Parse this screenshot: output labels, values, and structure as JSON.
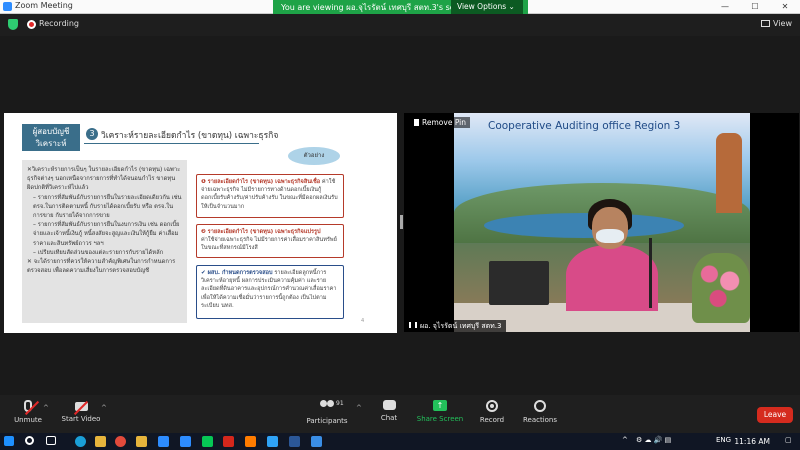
{
  "window": {
    "title": "Zoom Meeting",
    "minimize": "—",
    "maximize": "☐",
    "close": "✕"
  },
  "topbar": {
    "recording_label": "Recording",
    "view_label": "View"
  },
  "banner": {
    "text": "You are viewing ผอ.จุไรรัตน์ เทศบุรี สตท.3's screen",
    "options_label": "View Options ⌄"
  },
  "slide": {
    "section_box": "ผู้สอบบัญชี\nวิเคราะห์",
    "step_number": "3",
    "heading": "วิเคราะห์รายละเอียดกำไร (ขาดทุน) เฉพาะธุรกิจ",
    "example_label": "ตัวอย่าง",
    "left_items": [
      "✕วิเคราะห์รายการเป็นๆ ในรายละเอียดกำไร (ขาดทุน) เฉพาะธุรกิจต่างๆ นอกเหนือจากรายการที่ทำได้จนอนกำไร ขาดทุนผิดปกติที่วิเคราะห์ไปแล้ว",
      "– รายการที่สัมพันธ์กับรายการยืนในรายละเอียดเดียวกัน เช่น ตรจ.ในการติดตามหนี้ กับรายได้ดอกเบี้ยรับ หรือ ตรจ.ในการขาย กับรายได้จากการขาย",
      "– รายการที่สัมพันธ์กับรายการยืนในงบการเงิน เช่น ดอกเบี้ยจ่ายและเจ้าหนี้เงินกู้ หนี้สงสัยจะสูญและเงินให้กู้ยืม ค่าเสื่อมราคาและสินทรัพย์ถาวร ฯลฯ",
      "– เปรียบเทียบสัดส่วนของแต่ละรายการกับรายได้หลัก",
      "✕ จะได้รายการที่ควรให้ความสำคัญพิเศษในการกำหนดการตรวจสอบ เพื่อลดความเสี่ยงในการตรวจสอบบัญชี"
    ],
    "box1": {
      "label": "❶ รายละเอียดกำไร (ขาดทุน) เฉพาะธุรกิจสินเชื่อ",
      "text": "ค่าใช้จ่ายเฉพาะธุรกิจ ไม่มีรายการทางด้านดอกเบี้ยเงินกู้ดอกเบี้ยรับค้างรับ/ค่าปรับค้างรับ ในขณะที่มีดอกผลเงินรับให้เป็นจำนวนมาก"
    },
    "box2": {
      "label": "❷ รายละเอียดกำไร (ขาดทุน) เฉพาะธุรกิจแปรรูป",
      "text": "ค่าใช้จ่ายเฉพาะธุรกิจ ไม่มีรายการค่าเสื่อมราคาสินทรัพย์ ในขณะที่สหกรณ์มีโรงสี"
    },
    "box3": {
      "label": "✔ ผสบ. กำหนดการตรวจสอบ",
      "text": "รายละเอียดลูกหนี้การวิเคราะห์อายุหนี้ ผลการประเมินความคุ้มค่า และรายละเอียดที่ดินอาคารและอุปกรณ์การคำนวณค่าเสื่อมราคา เพื่อให้ได้ความเชื่อมั่นว่ารายการนี้ถูกต้อง เป็นไปตามระเบียบ นทส."
    },
    "slide_number": "4"
  },
  "video": {
    "title": "Cooperative Auditing office Region 3",
    "remove_pin": "Remove Pin",
    "participant_name": "ผอ. จุไรรัตน์ เทศบุรี สตท.3"
  },
  "toolbar": {
    "unmute": "Unmute",
    "start_video": "Start Video",
    "participants": "Participants",
    "participants_count": "91",
    "chat": "Chat",
    "share_screen": "Share Screen",
    "record": "Record",
    "reactions": "Reactions",
    "leave": "Leave"
  },
  "taskbar": {
    "lang": "ENG",
    "time": "11:16 AM",
    "date": ""
  }
}
